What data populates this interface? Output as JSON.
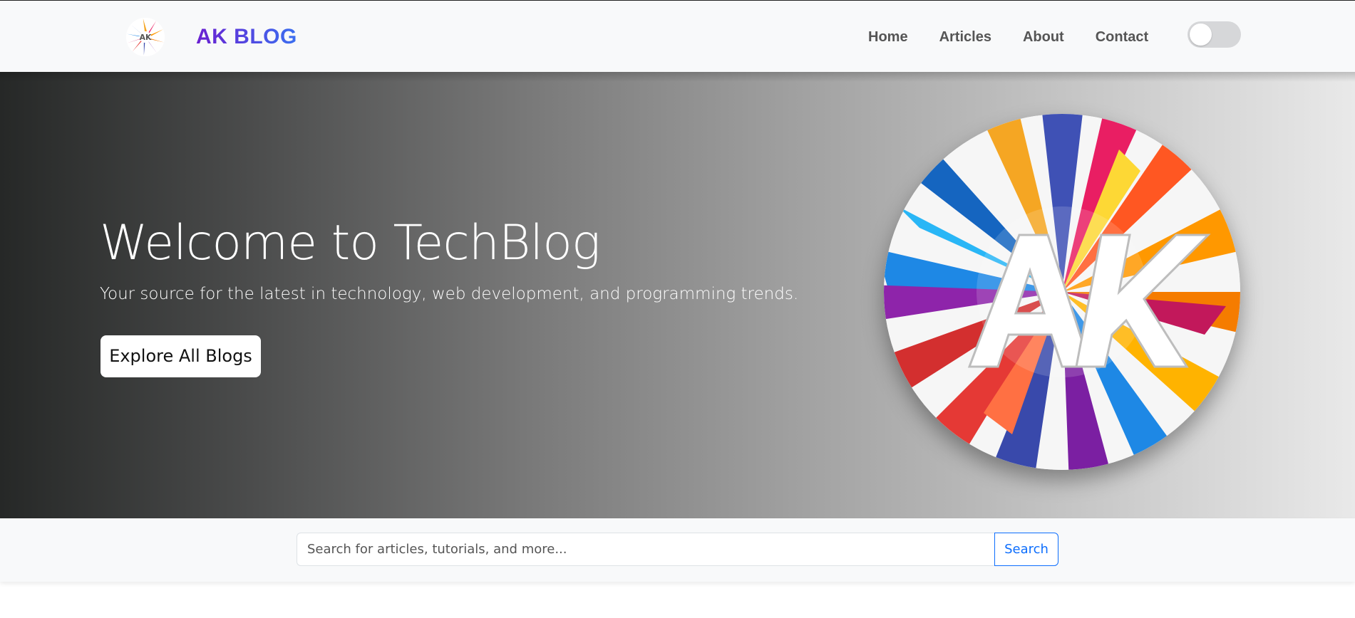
{
  "navbar": {
    "brand_text": "AK BLOG",
    "brand_logo_icon": "ak-splash-logo-icon",
    "links": [
      {
        "label": "Home"
      },
      {
        "label": "Articles"
      },
      {
        "label": "About"
      },
      {
        "label": "Contact"
      }
    ],
    "theme_toggle": {
      "state": "off"
    }
  },
  "hero": {
    "title": "Welcome to TechBlog",
    "subtitle": "Your source for the latest in technology, web development, and programming trends.",
    "button_label": "Explore All Blogs",
    "image_icon": "ak-splash-logo-icon"
  },
  "search": {
    "placeholder": "Search for articles, tutorials, and more...",
    "value": "",
    "button_label": "Search"
  },
  "colors": {
    "brand_gradient_start": "#6a1fd1",
    "brand_gradient_end": "#3a6ff0",
    "search_accent": "#0d6efd",
    "navbar_bg": "#f8f9fa"
  }
}
